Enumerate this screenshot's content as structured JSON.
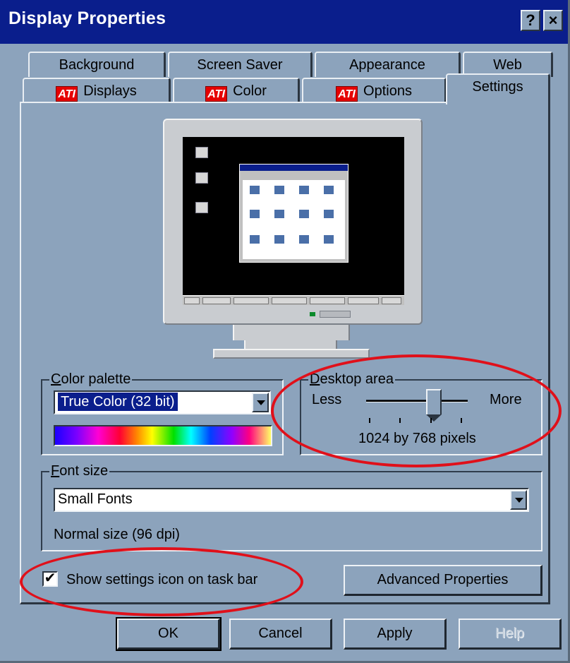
{
  "window": {
    "title": "Display Properties",
    "help_button": "?",
    "close_button": "×"
  },
  "tabs": {
    "row1": [
      "Background",
      "Screen Saver",
      "Appearance",
      "Web"
    ],
    "row2": [
      {
        "label": "Displays",
        "icon": "ati-logo-icon"
      },
      {
        "label": "Color",
        "icon": "ati-logo-icon"
      },
      {
        "label": "Options",
        "icon": "ati-logo-icon"
      },
      {
        "label": "Settings",
        "icon": null
      }
    ],
    "ati_text": "ATI",
    "active": "Settings"
  },
  "color_palette": {
    "label": "Color palette",
    "value": "True Color (32 bit)"
  },
  "desktop_area": {
    "label": "Desktop area",
    "less_label": "Less",
    "more_label": "More",
    "resolution_text": "1024 by 768 pixels",
    "slider_fraction": 0.7
  },
  "font_size": {
    "label": "Font size",
    "value": "Small Fonts",
    "description": "Normal size (96 dpi)"
  },
  "show_icon": {
    "label": "Show settings icon on task bar",
    "checked": true
  },
  "buttons": {
    "advanced": "Advanced Properties",
    "ok": "OK",
    "cancel": "Cancel",
    "apply": "Apply",
    "help": "Help"
  },
  "colors": {
    "face": "#8ca3bc",
    "title_bar": "#0a1e8c",
    "annotation": "#e0101a"
  }
}
